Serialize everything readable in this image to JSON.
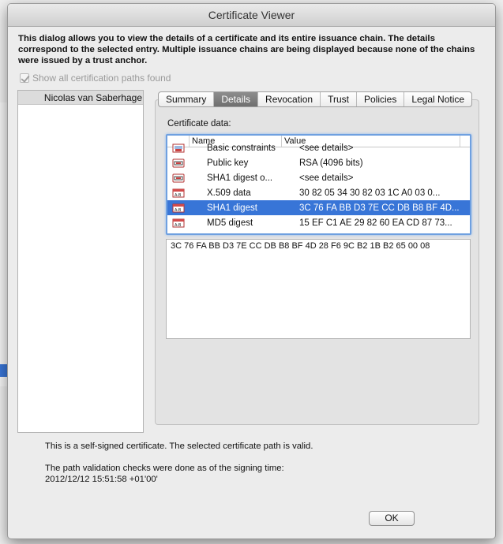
{
  "window": {
    "title": "Certificate Viewer"
  },
  "intro": "This dialog allows you to view the details of a certificate and its entire issuance chain. The details correspond to the selected entry. Multiple issuance chains are being displayed because none of the chains were issued by a trust anchor.",
  "show_all_paths": {
    "label": "Show all certification paths found",
    "checked": true,
    "enabled": false
  },
  "path_list": {
    "selected": "Nicolas van Saberhage"
  },
  "tabs": [
    {
      "label": "Summary",
      "active": false
    },
    {
      "label": "Details",
      "active": true
    },
    {
      "label": "Revocation",
      "active": false
    },
    {
      "label": "Trust",
      "active": false
    },
    {
      "label": "Policies",
      "active": false
    },
    {
      "label": "Legal Notice",
      "active": false
    }
  ],
  "details": {
    "certificate_data_label": "Certificate data:",
    "columns": {
      "name": "Name",
      "value": "Value"
    },
    "rows": [
      {
        "icon": "certificate-icon",
        "name": "Basic constraints",
        "value": "<see details>",
        "selected": false
      },
      {
        "icon": "key-icon",
        "name": "Public key",
        "value": "RSA (4096 bits)",
        "selected": false
      },
      {
        "icon": "key-icon",
        "name": "SHA1 digest o...",
        "value": "<see details>",
        "selected": false
      },
      {
        "icon": "data-icon",
        "name": "X.509 data",
        "value": "30 82 05 34 30 82 03 1C A0 03 0...",
        "selected": false
      },
      {
        "icon": "data-icon",
        "name": "SHA1 digest",
        "value": "3C 76 FA BB D3 7E CC DB B8 BF 4D...",
        "selected": true
      },
      {
        "icon": "data-icon",
        "name": "MD5 digest",
        "value": "15 EF C1 AE 29 82 60 EA CD 87 73...",
        "selected": false
      }
    ],
    "selected_value": "3C 76 FA BB D3 7E CC DB B8 BF 4D 28 F6 9C B2 1B B2 65 00 08"
  },
  "status": {
    "line1": "This is a self-signed certificate. The selected certificate path is valid.",
    "line2": "The path validation checks were done as of the signing time:",
    "line3": "2012/12/12 15:51:58 +01'00'"
  },
  "ok_label": "OK",
  "colors": {
    "selection": "#3875d7",
    "focus_ring": "#6fa0e0"
  }
}
